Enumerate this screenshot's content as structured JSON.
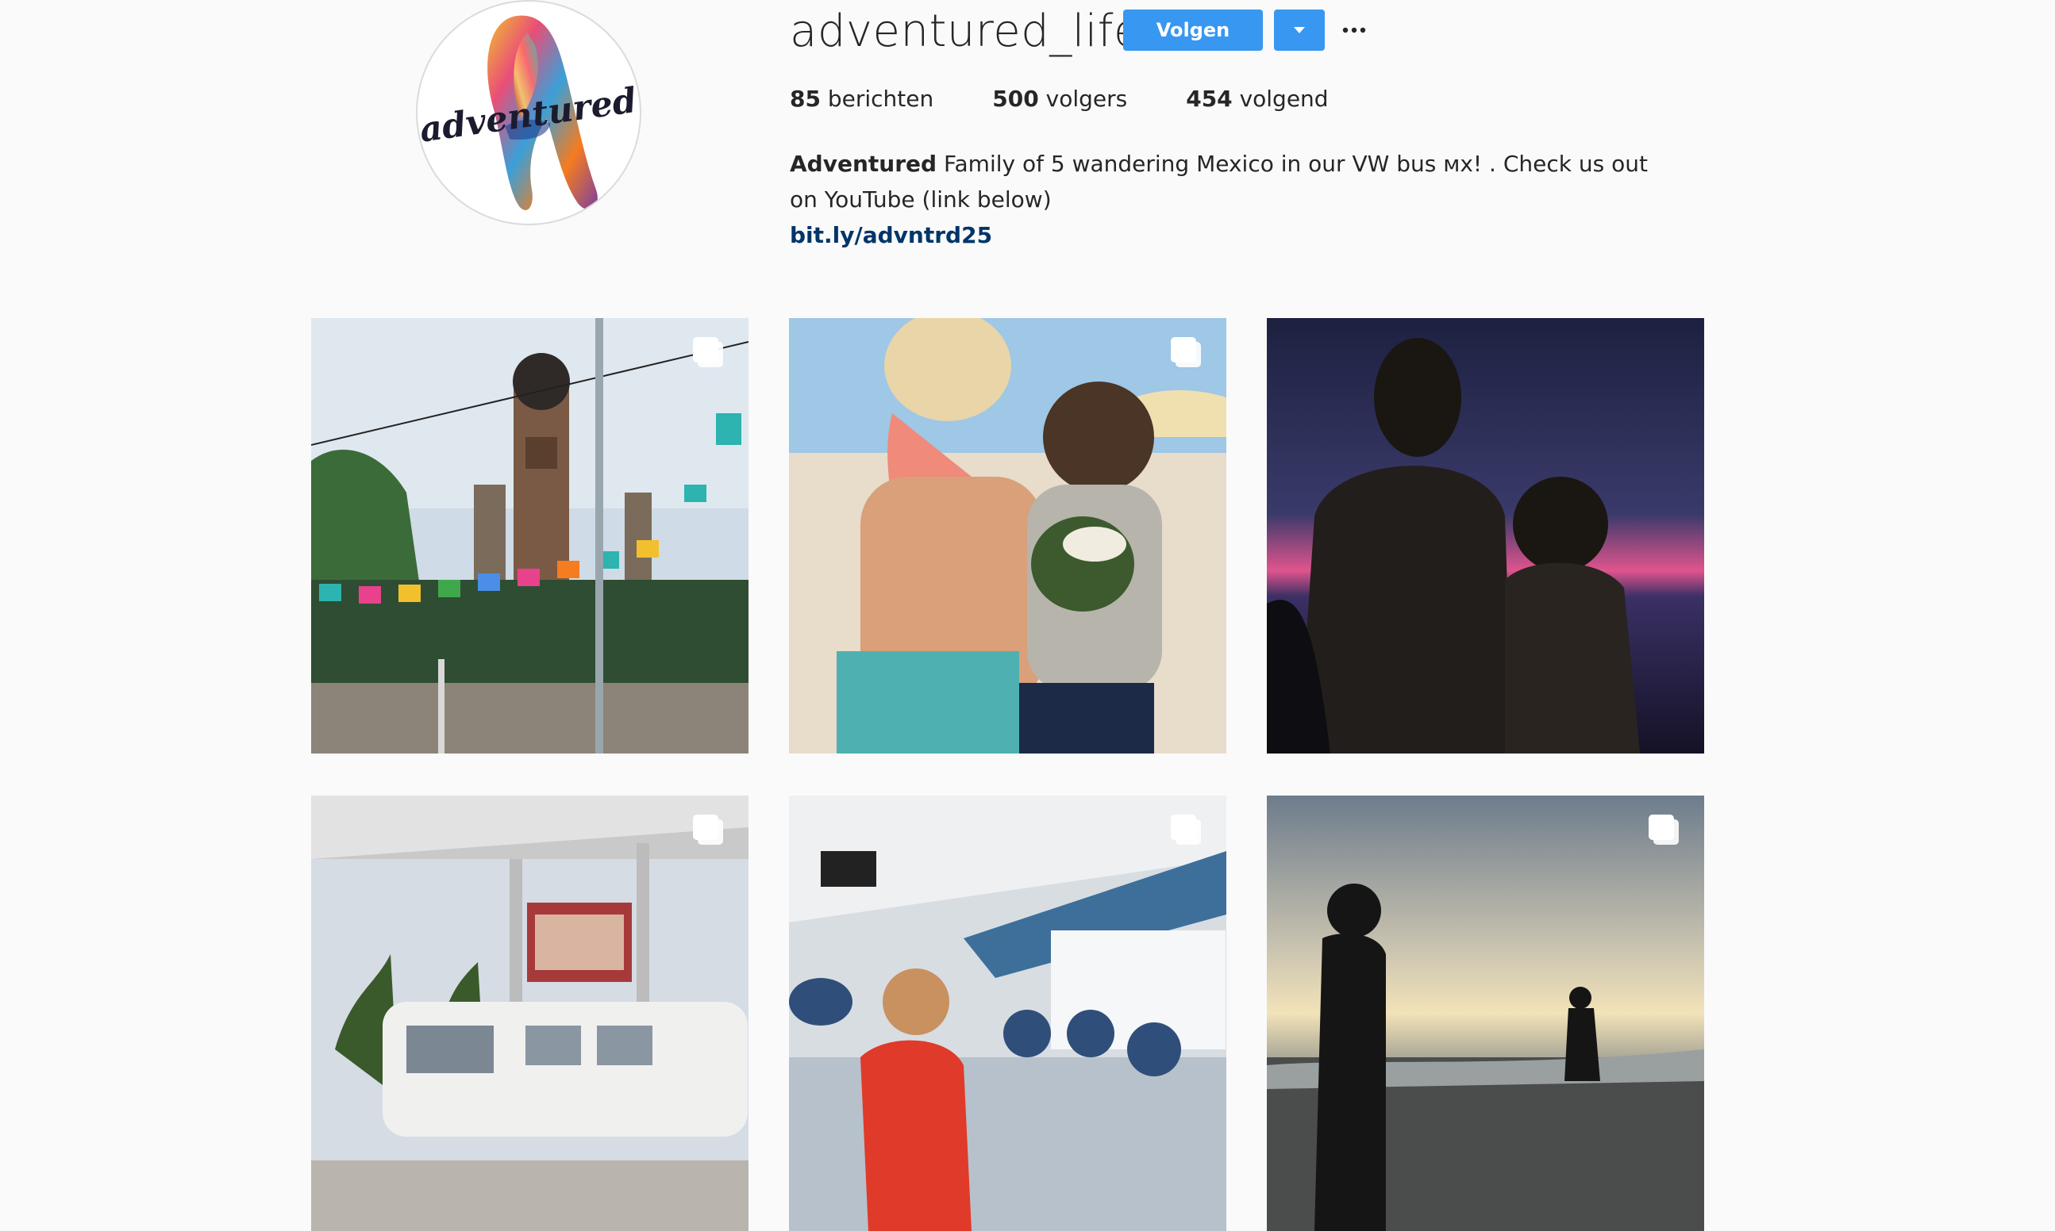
{
  "profile": {
    "username": "adventured_life",
    "avatar_logo_text": "adventured",
    "follow_label": "Volgen",
    "dropdown_icon": "caret-down-icon",
    "more_icon": "ellipsis-icon",
    "stats": [
      {
        "count": "85",
        "label": "berichten"
      },
      {
        "count": "500",
        "label": "volgers"
      },
      {
        "count": "454",
        "label": "volgend"
      }
    ],
    "bio_name": "Adventured",
    "bio_text": "Family of 5 wandering Mexico in our VW bus ᴍx! . Check us out on YouTube (link below)",
    "bio_link": "bit.ly/advntrd25"
  },
  "colors": {
    "accent": "#3897f0",
    "link": "#003569",
    "text": "#262626",
    "background": "#fafafa"
  },
  "posts": [
    {
      "subject": "church-plaza-papel-picado",
      "multi": true
    },
    {
      "subject": "kids-drinking-coconut-beach",
      "multi": true
    },
    {
      "subject": "mother-child-sunset-silhouette",
      "multi": false
    },
    {
      "subject": "vw-bus-at-gas-station",
      "multi": true
    },
    {
      "subject": "child-in-ferry-cabin",
      "multi": true
    },
    {
      "subject": "child-silhouette-beach-sunset",
      "multi": true
    }
  ]
}
